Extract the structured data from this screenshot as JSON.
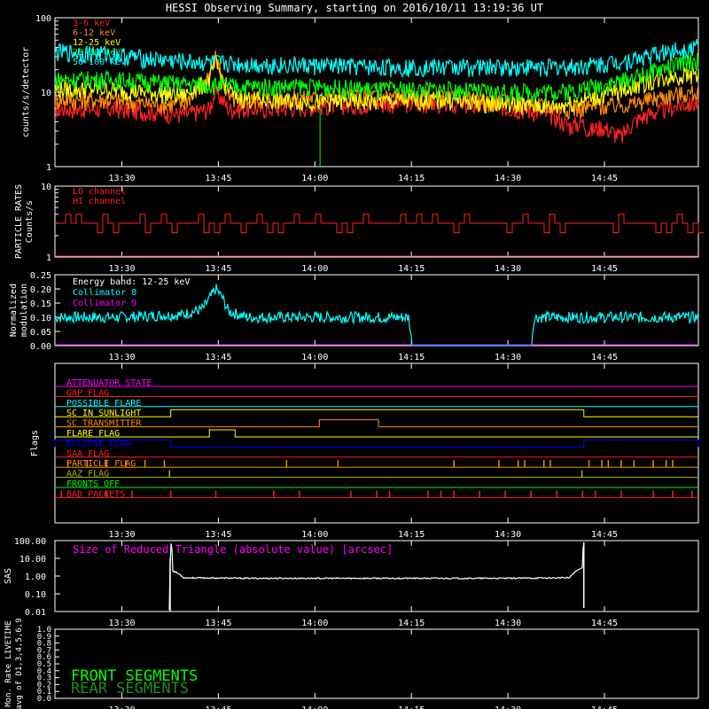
{
  "title": "HESSI Observing Summary, starting on 2016/10/11 13:19:36 UT",
  "time_ticks": [
    "13:30",
    "13:45",
    "14:00",
    "14:15",
    "14:30",
    "14:45"
  ],
  "colors": {
    "red": "#ff2020",
    "orange": "#ff8c00",
    "yellow": "#ffff00",
    "green": "#00ff00",
    "cyan": "#00ffff",
    "magenta": "#ff00ff",
    "blue": "#0000ff",
    "olive": "#b4b400"
  },
  "chart_data": [
    {
      "type": "line",
      "name": "count-rates",
      "ylabel": "counts/s/detector",
      "yscale": "log",
      "ylim": [
        1,
        100
      ],
      "ytick_labels": [
        "1",
        "10",
        "100"
      ],
      "legend": [
        "3-6 keV",
        "6-12 keV",
        "12-25 keV",
        "25-50 keV",
        "50-100 keV"
      ],
      "x_minutes_range": [
        0,
        100
      ],
      "series": [
        {
          "name": "3-6 keV",
          "color": "red",
          "x": [
            0,
            8,
            15,
            20,
            24,
            25,
            27,
            32,
            40,
            50,
            60,
            68,
            72,
            75,
            78,
            80,
            82,
            83,
            85,
            88,
            90,
            92,
            95,
            98,
            100
          ],
          "values": [
            6,
            6,
            5.5,
            5,
            6,
            10,
            6,
            6,
            6.5,
            7,
            7,
            6.5,
            6,
            5.5,
            4.5,
            3.5,
            4,
            3,
            3.5,
            2.5,
            4,
            5,
            6,
            7,
            7
          ]
        },
        {
          "name": "6-12 keV",
          "color": "orange",
          "x": [
            0,
            8,
            15,
            20,
            24,
            25,
            26,
            27,
            30,
            40,
            50,
            60,
            70,
            80,
            90,
            95,
            100
          ],
          "values": [
            8,
            8,
            7,
            7,
            15,
            30,
            15,
            8,
            8,
            8.5,
            9,
            8.5,
            7.5,
            6,
            7,
            9,
            10
          ]
        },
        {
          "name": "12-25 keV",
          "color": "yellow",
          "x": [
            0,
            8,
            15,
            20,
            24,
            25,
            26,
            28,
            32,
            40,
            50,
            60,
            70,
            78,
            85,
            90,
            95,
            100
          ],
          "values": [
            11,
            11,
            10,
            9,
            14,
            25,
            14,
            8.5,
            8,
            7.5,
            7.5,
            8,
            7,
            6.5,
            9,
            12,
            16,
            18
          ]
        },
        {
          "name": "25-50 keV",
          "color": "green",
          "x": [
            0,
            8,
            15,
            20,
            25,
            30,
            40,
            50,
            60,
            70,
            80,
            88,
            92,
            96,
            100
          ],
          "values": [
            15,
            15,
            14,
            13,
            12.5,
            12,
            12,
            11,
            11,
            10,
            10.5,
            14,
            18,
            23,
            27
          ]
        },
        {
          "name": "50-100 keV",
          "color": "cyan",
          "x": [
            0,
            8,
            15,
            20,
            25,
            30,
            40,
            50,
            60,
            70,
            80,
            85,
            90,
            95,
            100
          ],
          "values": [
            35,
            33,
            28,
            26,
            25,
            24,
            23,
            22,
            22,
            22,
            22,
            24,
            28,
            35,
            42
          ]
        }
      ]
    },
    {
      "type": "line",
      "name": "particle-rates",
      "ylabel_line1": "PARTICLE RATES",
      "ylabel_line2": "Counts/s",
      "yscale": "log",
      "ylim": [
        1,
        10
      ],
      "ytick_labels": [
        "1",
        "10"
      ],
      "legend": [
        "LO channel",
        "HI channel"
      ],
      "series": [
        {
          "name": "LO channel",
          "color": "red",
          "baseline": 3.0,
          "values": [
            3
          ]
        },
        {
          "name": "HI channel",
          "color": "red",
          "values": [
            1
          ]
        }
      ]
    },
    {
      "type": "line",
      "name": "modulation",
      "ylabel_line1": "Normalized",
      "ylabel_line2": "modulation",
      "ylim": [
        0,
        0.25
      ],
      "ytick_labels": [
        "0.00",
        "0.05",
        "0.10",
        "0.15",
        "0.20",
        "0.25"
      ],
      "legend": [
        "Energy band: 12-25 keV",
        "Collimator 8",
        "Collimator 9"
      ],
      "series": [
        {
          "name": "Collimator 8",
          "color": "cyan",
          "x": [
            0,
            10,
            20,
            23,
            25,
            26,
            27,
            30,
            40,
            50,
            55,
            55.5,
            74,
            74.5,
            80,
            90,
            100
          ],
          "values": [
            0.1,
            0.1,
            0.11,
            0.13,
            0.2,
            0.17,
            0.12,
            0.1,
            0.1,
            0.1,
            0.1,
            0,
            0,
            0.1,
            0.1,
            0.1,
            0.1
          ]
        }
      ]
    },
    {
      "type": "line",
      "name": "flags",
      "ylabel": "Flags",
      "flags": [
        {
          "name": "ATTENUATOR STATE",
          "color": "magenta",
          "segments": []
        },
        {
          "name": "GAP FLAG",
          "color": "red",
          "segments": []
        },
        {
          "name": "POSSIBLE FLARE",
          "color": "cyan",
          "segments": []
        },
        {
          "name": "SC IN SUNLIGHT",
          "color": "yellow",
          "segments": [
            [
              18.0,
              82.2
            ]
          ]
        },
        {
          "name": "SC TRANSMITTER",
          "color": "orange",
          "segments": [
            [
              41.1,
              50.3
            ]
          ]
        },
        {
          "name": "FLARE FLAG",
          "color": "yellow",
          "segments": [
            [
              24.0,
              28.0
            ]
          ]
        },
        {
          "name": "ECLIPSE FLAG",
          "color": "blue",
          "segments": [
            [
              0,
              18.0
            ],
            [
              82.2,
              100
            ]
          ]
        },
        {
          "name": "SAA FLAG",
          "color": "red",
          "segments": []
        },
        {
          "name": "PARTICLE FLAG",
          "color": "orange",
          "spikes": [
            2,
            5,
            8,
            11,
            14,
            17,
            36,
            44,
            62,
            69,
            72,
            73,
            76,
            77,
            83,
            85,
            86,
            88,
            90,
            93,
            95,
            96
          ]
        },
        {
          "name": "AAZ FLAG",
          "color": "olive",
          "spikes": [
            17.8,
            81.9
          ]
        },
        {
          "name": "FRONTS OFF",
          "color": "green",
          "segments": []
        },
        {
          "name": "BAD PACKETS",
          "color": "red",
          "spikes": [
            1,
            8,
            12,
            18,
            25,
            34,
            38,
            46,
            50,
            52,
            58,
            60,
            62,
            66,
            70,
            74,
            78,
            82,
            84,
            88,
            93,
            96,
            99
          ]
        }
      ]
    },
    {
      "type": "line",
      "name": "sas",
      "ylabel": "SAS",
      "yscale": "log",
      "ylim": [
        0.01,
        100
      ],
      "ytick_labels": [
        "0.01",
        "0.10",
        "1.00",
        "10.00",
        "100.00"
      ],
      "legend": [
        "Size of Reduced Triangle (absolute value) [arcsec]"
      ],
      "series": [
        {
          "name": "Size of Reduced Triangle (absolute value) [arcsec]",
          "color": "white",
          "x": [
            17.9,
            18.0,
            18.3,
            20,
            30,
            40,
            50,
            60,
            70,
            80,
            82.0,
            82.2
          ],
          "values": [
            0.012,
            80,
            2,
            0.8,
            0.75,
            0.75,
            0.75,
            0.75,
            0.75,
            0.8,
            3,
            80
          ]
        }
      ]
    },
    {
      "type": "line",
      "name": "livetime",
      "ylabel_line1": "Mon. Rate LIVETIME",
      "ylabel_line2": "avg of D1,3,4,5,6,9",
      "ylim": [
        0,
        1
      ],
      "ytick_labels": [
        "0.0",
        "0.1",
        "0.2",
        "0.3",
        "0.4",
        "0.5",
        "0.6",
        "0.7",
        "0.8",
        "0.9",
        "1.0"
      ],
      "legend": [
        "FRONT SEGMENTS",
        "REAR SEGMENTS"
      ],
      "series": []
    }
  ]
}
